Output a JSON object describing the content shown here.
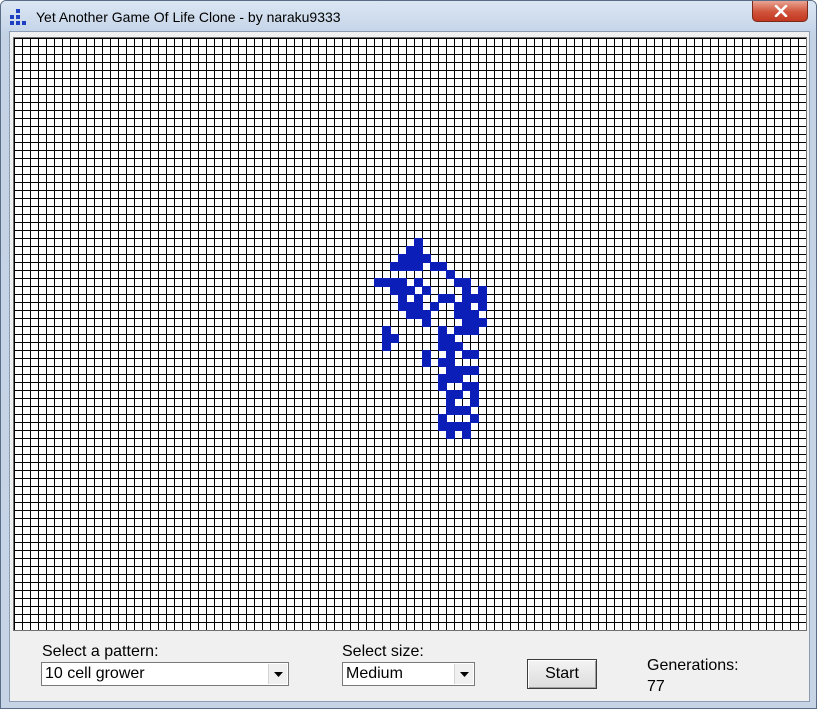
{
  "window": {
    "title": "Yet Another Game Of Life Clone - by naraku9333"
  },
  "controls": {
    "pattern_label": "Select a pattern:",
    "pattern_value": "10 cell grower",
    "size_label": "Select size:",
    "size_value": "Medium",
    "start_label": "Start",
    "generations_label": "Generations:",
    "generations_value": "77"
  },
  "board": {
    "columns": 99,
    "rows": 74,
    "live_color": "#0b1fb8",
    "grid_color": "#000000",
    "live_cells": [
      [
        50,
        25
      ],
      [
        49,
        26
      ],
      [
        50,
        26
      ],
      [
        48,
        27
      ],
      [
        49,
        27
      ],
      [
        50,
        27
      ],
      [
        51,
        27
      ],
      [
        47,
        28
      ],
      [
        48,
        28
      ],
      [
        49,
        28
      ],
      [
        50,
        28
      ],
      [
        52,
        28
      ],
      [
        53,
        28
      ],
      [
        54,
        29
      ],
      [
        45,
        30
      ],
      [
        46,
        30
      ],
      [
        47,
        30
      ],
      [
        48,
        30
      ],
      [
        50,
        30
      ],
      [
        55,
        30
      ],
      [
        56,
        30
      ],
      [
        47,
        31
      ],
      [
        48,
        31
      ],
      [
        49,
        31
      ],
      [
        51,
        31
      ],
      [
        56,
        31
      ],
      [
        58,
        31
      ],
      [
        48,
        32
      ],
      [
        50,
        32
      ],
      [
        53,
        32
      ],
      [
        54,
        32
      ],
      [
        56,
        32
      ],
      [
        57,
        32
      ],
      [
        58,
        32
      ],
      [
        48,
        33
      ],
      [
        49,
        33
      ],
      [
        50,
        33
      ],
      [
        52,
        33
      ],
      [
        55,
        33
      ],
      [
        56,
        33
      ],
      [
        58,
        33
      ],
      [
        49,
        34
      ],
      [
        50,
        34
      ],
      [
        51,
        34
      ],
      [
        55,
        34
      ],
      [
        56,
        34
      ],
      [
        57,
        34
      ],
      [
        51,
        35
      ],
      [
        56,
        35
      ],
      [
        57,
        35
      ],
      [
        58,
        35
      ],
      [
        46,
        36
      ],
      [
        53,
        36
      ],
      [
        55,
        36
      ],
      [
        56,
        36
      ],
      [
        57,
        36
      ],
      [
        46,
        37
      ],
      [
        47,
        37
      ],
      [
        53,
        37
      ],
      [
        54,
        37
      ],
      [
        46,
        38
      ],
      [
        53,
        38
      ],
      [
        54,
        38
      ],
      [
        55,
        38
      ],
      [
        51,
        39
      ],
      [
        54,
        39
      ],
      [
        56,
        39
      ],
      [
        57,
        39
      ],
      [
        51,
        40
      ],
      [
        53,
        40
      ],
      [
        54,
        40
      ],
      [
        54,
        41
      ],
      [
        55,
        41
      ],
      [
        56,
        41
      ],
      [
        57,
        41
      ],
      [
        53,
        42
      ],
      [
        54,
        42
      ],
      [
        55,
        42
      ],
      [
        53,
        43
      ],
      [
        56,
        43
      ],
      [
        57,
        43
      ],
      [
        54,
        44
      ],
      [
        55,
        44
      ],
      [
        57,
        44
      ],
      [
        54,
        45
      ],
      [
        57,
        45
      ],
      [
        54,
        46
      ],
      [
        55,
        46
      ],
      [
        56,
        46
      ],
      [
        53,
        47
      ],
      [
        57,
        47
      ],
      [
        53,
        48
      ],
      [
        54,
        48
      ],
      [
        55,
        48
      ],
      [
        56,
        48
      ],
      [
        54,
        49
      ],
      [
        56,
        49
      ]
    ]
  }
}
